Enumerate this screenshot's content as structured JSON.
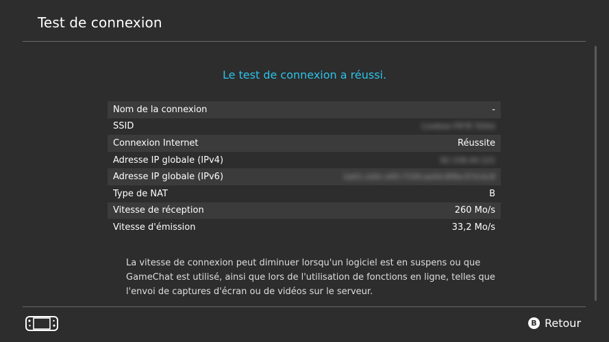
{
  "header": {
    "title": "Test de connexion"
  },
  "result": {
    "message": "Le test de connexion a réussi."
  },
  "info_rows": [
    {
      "label": "Nom de la connexion",
      "value": "-"
    },
    {
      "label": "SSID",
      "value": "Livebox-FR7E 5GHz"
    },
    {
      "label": "Connexion Internet",
      "value": "Réussite"
    },
    {
      "label": "Adresse IP globale (IPv4)",
      "value": "92.158.44.121"
    },
    {
      "label": "Adresse IP globale (IPv6)",
      "value": "2a01:cb0c:d45:7100:ae0d:8f9a:07d:bc8"
    },
    {
      "label": "Type de NAT",
      "value": "B"
    },
    {
      "label": "Vitesse de réception",
      "value": "260 Mo/s"
    },
    {
      "label": "Vitesse d'émission",
      "value": "33,2 Mo/s"
    }
  ],
  "note": "La vitesse de connexion peut diminuer lorsqu'un logiciel est en suspens ou que GameChat est utilisé, ainsi que lors de l'utilisation de fonctions en ligne, telles que l'envoi de captures d'écran ou de vidéos sur le serveur.",
  "footer": {
    "back_key": "B",
    "back_label": "Retour"
  },
  "colors": {
    "background": "#2d2d2d",
    "accent": "#2bc3ea",
    "row_shade": "#3b3b3b"
  },
  "icons": {
    "controller": "switch-console-icon"
  }
}
